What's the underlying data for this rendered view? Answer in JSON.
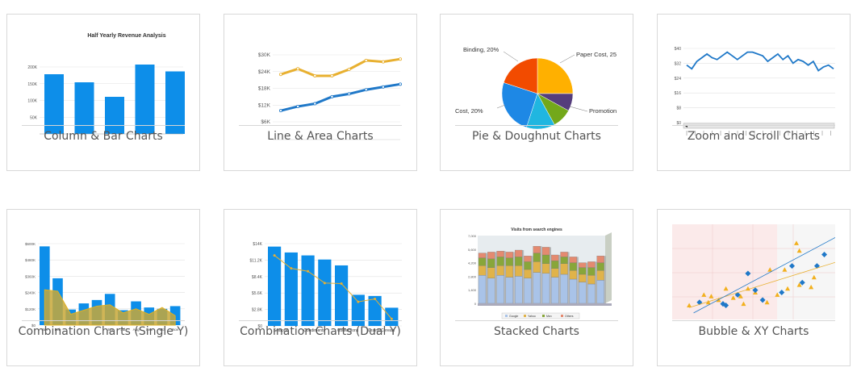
{
  "cards": [
    {
      "title": "Column & Bar Charts"
    },
    {
      "title": "Line & Area Charts"
    },
    {
      "title": "Pie & Doughnut Charts"
    },
    {
      "title": "Zoom and Scroll Charts"
    },
    {
      "title": "Combination Charts (Single Y)"
    },
    {
      "title": "Combination Charts (Dual Y)"
    },
    {
      "title": "Stacked Charts"
    },
    {
      "title": "Bubble & XY Charts"
    }
  ],
  "chart_data": [
    {
      "type": "bar",
      "title": "Half Yearly Revenue Analysis",
      "yticks": [
        "200K",
        "150K",
        "100K",
        "50K"
      ],
      "ylim": [
        0,
        200000
      ],
      "values": [
        148000,
        128000,
        92000,
        172000,
        155000
      ],
      "color": "#0d8ee9"
    },
    {
      "type": "line",
      "yticks": [
        "$30K",
        "$24K",
        "$18K",
        "$12K",
        "$6K"
      ],
      "ylim": [
        0,
        30000
      ],
      "series": [
        {
          "values": [
            23000,
            25000,
            22500,
            22500,
            24800,
            28000,
            27500,
            28500
          ],
          "color": "#e8b030"
        },
        {
          "values": [
            10000,
            11500,
            12500,
            15000,
            16000,
            17500,
            18500,
            19500
          ],
          "color": "#1f78c8"
        }
      ]
    },
    {
      "type": "pie",
      "labels": [
        "Paper Cost, 25",
        "Promotion",
        "Cost, 20%",
        "Binding, 20%"
      ],
      "slices": [
        {
          "value": 25,
          "color": "#ffb000"
        },
        {
          "value": 8,
          "color": "#553d7c"
        },
        {
          "value": 9,
          "color": "#73a81a"
        },
        {
          "value": 13,
          "color": "#20b6e0"
        },
        {
          "value": 25,
          "color": "#1e88e5"
        },
        {
          "value": 20,
          "color": "#f24b00"
        }
      ]
    },
    {
      "type": "line",
      "yticks": [
        "$40",
        "$32",
        "$24",
        "$16",
        "$8",
        "$0"
      ],
      "ylim": [
        0,
        40
      ],
      "values": [
        31,
        29,
        33,
        35,
        37,
        35,
        34,
        36,
        38,
        36,
        34,
        36,
        38,
        38,
        37,
        36,
        33,
        35,
        37,
        34,
        36,
        32,
        34,
        33,
        31,
        33,
        28,
        30,
        31,
        29
      ],
      "color": "#1f78c8"
    },
    {
      "type": "bar",
      "categories": [
        "Jan",
        "Feb",
        "Mar",
        "Apr",
        "May",
        "Jun",
        "Jul",
        "Aug",
        "Sep",
        "Oct",
        "Nov"
      ],
      "xticks": [
        "Jan",
        "Feb",
        "Jun",
        "Jul",
        "Aug",
        "Sep",
        "Oct",
        "Nov"
      ],
      "yticks": [
        "$600K",
        "$480K",
        "$360K",
        "$240K",
        "$120K",
        "$0"
      ],
      "ylim": [
        0,
        600000
      ],
      "values": [
        580000,
        345000,
        115000,
        160000,
        185000,
        230000,
        110000,
        175000,
        130000,
        120000,
        140000
      ],
      "area": [
        260000,
        250000,
        80000,
        110000,
        140000,
        150000,
        90000,
        120000,
        80000,
        130000,
        70000
      ],
      "bar_color": "#0d8ee9",
      "area_color": "#c8a838"
    },
    {
      "type": "bar",
      "xticks": [
        "Seafood",
        "Condiments",
        "Confections",
        "Grains/Cereals"
      ],
      "yticks": [
        "$14K",
        "$11.2K",
        "$8.4K",
        "$5.6K",
        "$2.8K",
        "$0"
      ],
      "ylim": [
        0,
        14000
      ],
      "values": [
        13500,
        12500,
        12000,
        11300,
        10300,
        5300,
        5100,
        3100
      ],
      "line": [
        12000,
        9800,
        9300,
        7300,
        7200,
        4100,
        4600,
        1200
      ],
      "bar_color": "#0d8ee9",
      "line_color": "#e8b030"
    },
    {
      "type": "bar",
      "title": "Visits from search engines",
      "yticks": [
        "7,000",
        "5,600",
        "4,200",
        "2,800",
        "1,400",
        "0"
      ],
      "ylim": [
        0,
        7000
      ],
      "legend": [
        "Google",
        "Yahoo",
        "Msn",
        "Others"
      ],
      "stacks": [
        [
          2900,
          1000,
          800,
          500
        ],
        [
          2600,
          1100,
          900,
          700
        ],
        [
          2900,
          1000,
          900,
          600
        ],
        [
          2700,
          1200,
          800,
          600
        ],
        [
          2800,
          1100,
          900,
          700
        ],
        [
          2600,
          900,
          800,
          600
        ],
        [
          3200,
          1100,
          900,
          700
        ],
        [
          3100,
          1000,
          900,
          800
        ],
        [
          2700,
          900,
          800,
          600
        ],
        [
          3000,
          1100,
          700,
          500
        ],
        [
          2500,
          900,
          800,
          600
        ],
        [
          2200,
          800,
          700,
          500
        ],
        [
          2000,
          900,
          800,
          600
        ],
        [
          2400,
          1000,
          800,
          700
        ]
      ],
      "colors": [
        "#a9c3e8",
        "#e0b34a",
        "#88a63a",
        "#e48a70"
      ]
    },
    {
      "type": "scatter",
      "series": [
        {
          "points": [
            [
              0.05,
              0.08
            ],
            [
              0.18,
              0.12
            ],
            [
              0.25,
              0.15
            ],
            [
              0.35,
              0.18
            ],
            [
              0.4,
              0.2
            ],
            [
              0.5,
              0.25
            ],
            [
              0.3,
              0.3
            ],
            [
              0.65,
              0.22
            ],
            [
              0.6,
              0.55
            ],
            [
              0.72,
              0.3
            ],
            [
              0.7,
              0.55
            ],
            [
              0.8,
              0.35
            ],
            [
              0.78,
              0.9
            ],
            [
              0.8,
              0.8
            ],
            [
              0.88,
              0.32
            ],
            [
              0.2,
              0.2
            ],
            [
              0.42,
              0.1
            ],
            [
              0.15,
              0.22
            ],
            [
              0.58,
              0.12
            ],
            [
              0.45,
              0.3
            ],
            [
              0.9,
              0.45
            ]
          ],
          "color": "#f2b01e"
        },
        {
          "points": [
            [
              0.12,
              0.12
            ],
            [
              0.28,
              0.1
            ],
            [
              0.3,
              0.08
            ],
            [
              0.38,
              0.22
            ],
            [
              0.45,
              0.5
            ],
            [
              0.5,
              0.28
            ],
            [
              0.55,
              0.15
            ],
            [
              0.75,
              0.6
            ],
            [
              0.82,
              0.38
            ],
            [
              0.92,
              0.6
            ],
            [
              0.97,
              0.75
            ],
            [
              0.68,
              0.25
            ]
          ],
          "color": "#1f78c8"
        }
      ]
    }
  ]
}
